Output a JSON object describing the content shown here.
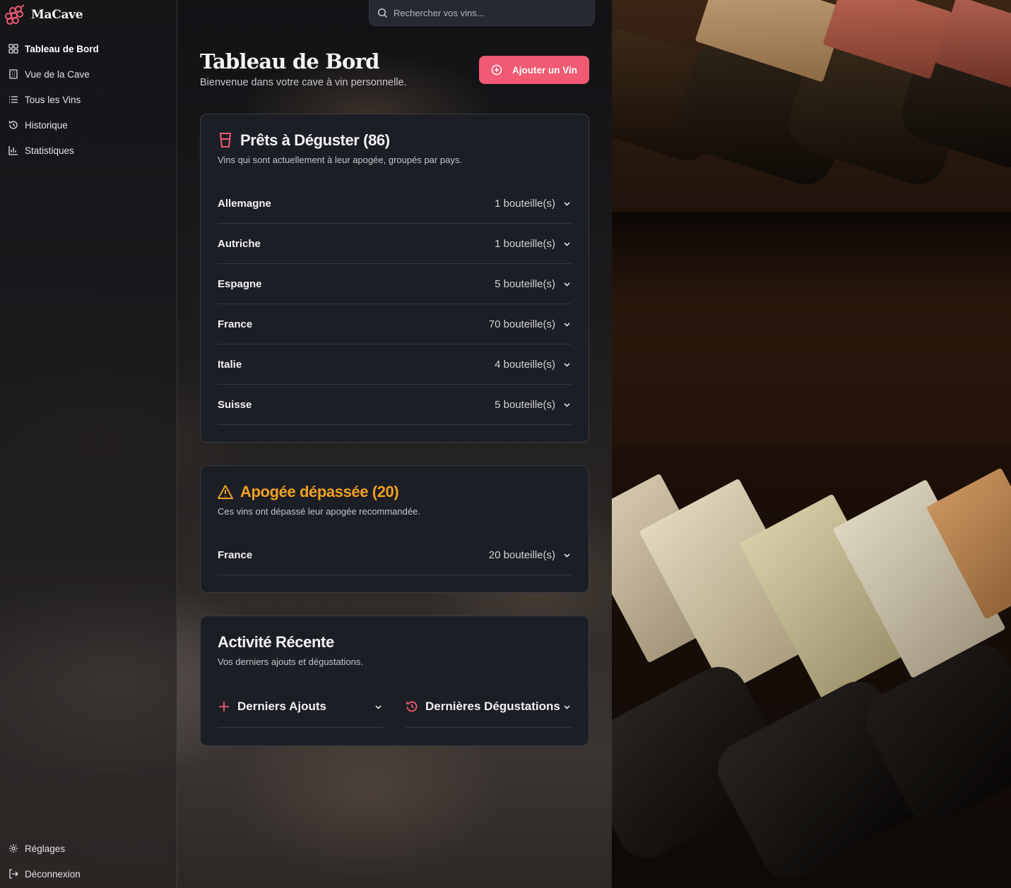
{
  "app": {
    "name": "MaCave"
  },
  "sidebar": {
    "items": [
      {
        "label": "Tableau de Bord",
        "icon": "dashboard-icon"
      },
      {
        "label": "Vue de la Cave",
        "icon": "building-icon"
      },
      {
        "label": "Tous les Vins",
        "icon": "list-icon"
      },
      {
        "label": "Historique",
        "icon": "history-icon"
      },
      {
        "label": "Statistiques",
        "icon": "bar-chart-icon"
      }
    ],
    "bottom": [
      {
        "label": "Réglages",
        "icon": "gear-icon"
      },
      {
        "label": "Déconnexion",
        "icon": "logout-icon"
      }
    ]
  },
  "search": {
    "placeholder": "Rechercher vos vins..."
  },
  "header": {
    "title": "Tableau de Bord",
    "subtitle": "Bienvenue dans votre cave à vin personnelle.",
    "add_button": "Ajouter un Vin"
  },
  "ready": {
    "title": "Prêts à Déguster (86)",
    "description": "Vins qui sont actuellement à leur apogée, groupés par pays.",
    "rows": [
      {
        "country": "Allemagne",
        "count": "1 bouteille(s)"
      },
      {
        "country": "Autriche",
        "count": "1 bouteille(s)"
      },
      {
        "country": "Espagne",
        "count": "5 bouteille(s)"
      },
      {
        "country": "France",
        "count": "70 bouteille(s)"
      },
      {
        "country": "Italie",
        "count": "4 bouteille(s)"
      },
      {
        "country": "Suisse",
        "count": "5 bouteille(s)"
      }
    ]
  },
  "past": {
    "title": "Apogée dépassée (20)",
    "description": "Ces vins ont dépassé leur apogée recommandée.",
    "rows": [
      {
        "country": "France",
        "count": "20 bouteille(s)"
      }
    ]
  },
  "activity": {
    "title": "Activité Récente",
    "description": "Vos derniers ajouts et dégustations.",
    "latest_additions": "Derniers Ajouts",
    "latest_tastings": "Dernières Dégustations"
  },
  "colors": {
    "accent": "#f05a73",
    "warning": "#f0a020",
    "card": "#1c1e25"
  }
}
